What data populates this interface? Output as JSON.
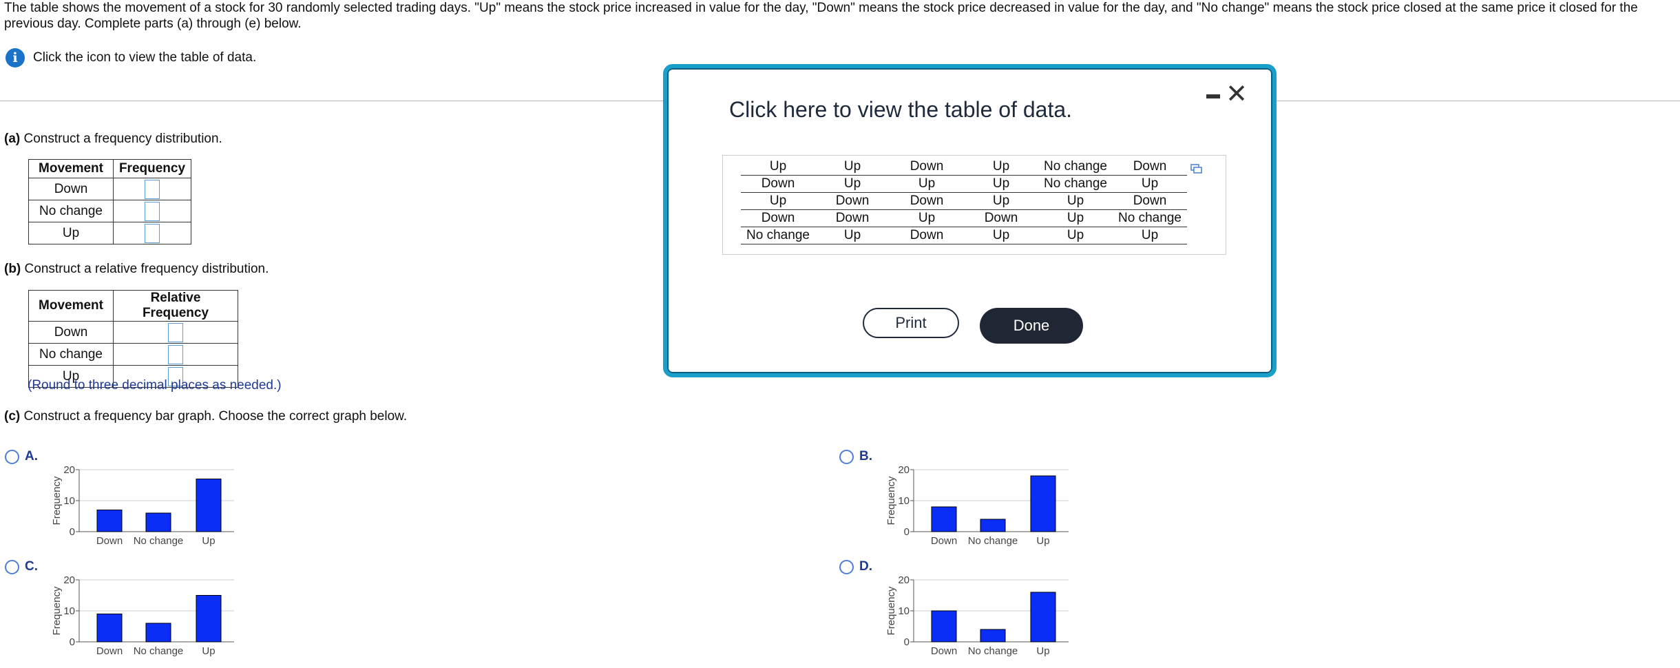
{
  "intro": "The table shows the movement of a stock for 30 randomly selected trading days. \"Up\" means the stock price increased in value for the day, \"Down\" means the stock price decreased in value for the day, and \"No change\" means the stock price closed at the same price it closed for the previous day. Complete parts (a) through (e) below.",
  "info_text": "Click the icon to view the table of data.",
  "info_icon": "i",
  "part_a": {
    "letter": "(a)",
    "text": "Construct a frequency distribution.",
    "headers": [
      "Movement",
      "Frequency"
    ],
    "rows": [
      "Down",
      "No change",
      "Up"
    ]
  },
  "part_b": {
    "letter": "(b)",
    "text": "Construct a relative frequency distribution.",
    "headers": [
      "Movement",
      "Relative Frequency"
    ],
    "rows": [
      "Down",
      "No change",
      "Up"
    ],
    "note": "(Round to three decimal places as needed.)"
  },
  "part_c": {
    "letter": "(c)",
    "text": "Construct a frequency bar graph. Choose the correct graph below."
  },
  "chart_data": [
    {
      "type": "bar",
      "option": "A.",
      "categories": [
        "Down",
        "No change",
        "Up"
      ],
      "values": [
        7,
        6,
        17
      ],
      "ylabel": "Frequency",
      "ylim": [
        0,
        20
      ],
      "yticks": [
        0,
        10,
        20
      ],
      "bar_color": "#0a2ef5"
    },
    {
      "type": "bar",
      "option": "B.",
      "categories": [
        "Down",
        "No change",
        "Up"
      ],
      "values": [
        8,
        4,
        18
      ],
      "ylabel": "Frequency",
      "ylim": [
        0,
        20
      ],
      "yticks": [
        0,
        10,
        20
      ],
      "bar_color": "#0a2ef5"
    },
    {
      "type": "bar",
      "option": "C.",
      "categories": [
        "Down",
        "No change",
        "Up"
      ],
      "values": [
        9,
        6,
        15
      ],
      "ylabel": "Frequency",
      "ylim": [
        0,
        20
      ],
      "yticks": [
        0,
        10,
        20
      ],
      "bar_color": "#0a2ef5"
    },
    {
      "type": "bar",
      "option": "D.",
      "categories": [
        "Down",
        "No change",
        "Up"
      ],
      "values": [
        10,
        4,
        16
      ],
      "ylabel": "Frequency",
      "ylim": [
        0,
        20
      ],
      "yticks": [
        0,
        10,
        20
      ],
      "bar_color": "#0a2ef5"
    }
  ],
  "modal": {
    "title": "Click here to view the table of data.",
    "close_glyph": "✕",
    "table": [
      [
        "Up",
        "Up",
        "Down",
        "Up",
        "No change",
        "Down"
      ],
      [
        "Down",
        "Up",
        "Up",
        "Up",
        "No change",
        "Up"
      ],
      [
        "Up",
        "Down",
        "Down",
        "Up",
        "Up",
        "Down"
      ],
      [
        "Down",
        "Down",
        "Up",
        "Down",
        "Up",
        "No change"
      ],
      [
        "No change",
        "Up",
        "Down",
        "Up",
        "Up",
        "Up"
      ]
    ],
    "print_label": "Print",
    "done_label": "Done"
  },
  "colors": {
    "accent": "#1aa0c8",
    "link": "#1f3a93",
    "bar": "#0a2ef5",
    "done_bg": "#1e2733"
  },
  "icons": {
    "info": "info-icon",
    "minimize": "minimize-icon",
    "close": "close-icon",
    "copy": "copy-icon"
  }
}
